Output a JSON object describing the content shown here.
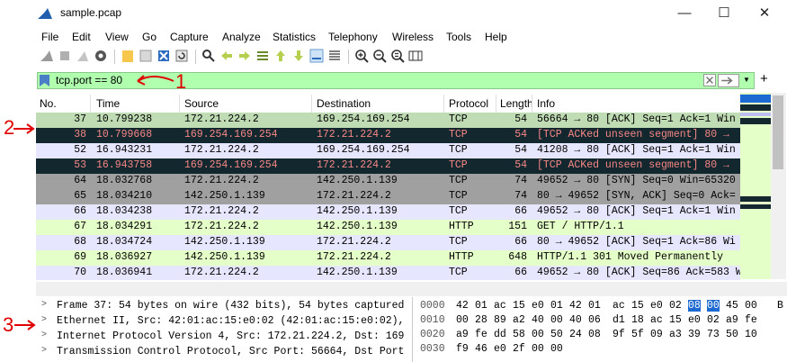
{
  "window": {
    "title": "sample.pcap",
    "minimize": "—",
    "maximize": "☐",
    "close": "✕"
  },
  "menu": [
    "File",
    "Edit",
    "View",
    "Go",
    "Capture",
    "Analyze",
    "Statistics",
    "Telephony",
    "Wireless",
    "Tools",
    "Help"
  ],
  "filter": {
    "value": "tcp.port == 80",
    "plus": "+"
  },
  "columns": [
    "No.",
    "Time",
    "Source",
    "Destination",
    "Protocol",
    "Length",
    "Info"
  ],
  "packets": [
    {
      "no": "37",
      "time": "10.799238",
      "src": "172.21.224.2",
      "dst": "169.254.169.254",
      "proto": "TCP",
      "len": "54",
      "info": "56664 → 80 [ACK] Seq=1 Ack=1 Win",
      "style": "selected"
    },
    {
      "no": "38",
      "time": "10.799668",
      "src": "169.254.169.254",
      "dst": "172.21.224.2",
      "proto": "TCP",
      "len": "54",
      "info": "[TCP ACKed unseen segment] 80 →",
      "style": "bad"
    },
    {
      "no": "52",
      "time": "16.943231",
      "src": "172.21.224.2",
      "dst": "169.254.169.254",
      "proto": "TCP",
      "len": "54",
      "info": "41208 → 80 [ACK] Seq=1 Ack=1 Win",
      "style": "tcp"
    },
    {
      "no": "53",
      "time": "16.943758",
      "src": "169.254.169.254",
      "dst": "172.21.224.2",
      "proto": "TCP",
      "len": "54",
      "info": "[TCP ACKed unseen segment] 80 →",
      "style": "bad"
    },
    {
      "no": "64",
      "time": "18.032768",
      "src": "172.21.224.2",
      "dst": "142.250.1.139",
      "proto": "TCP",
      "len": "74",
      "info": "49652 → 80 [SYN] Seq=0 Win=65320",
      "style": "syn"
    },
    {
      "no": "65",
      "time": "18.034210",
      "src": "142.250.1.139",
      "dst": "172.21.224.2",
      "proto": "TCP",
      "len": "74",
      "info": "80 → 49652 [SYN, ACK] Seq=0 Ack=",
      "style": "syn"
    },
    {
      "no": "66",
      "time": "18.034238",
      "src": "172.21.224.2",
      "dst": "142.250.1.139",
      "proto": "TCP",
      "len": "66",
      "info": "49652 → 80 [ACK] Seq=1 Ack=1 Win",
      "style": "tcp"
    },
    {
      "no": "67",
      "time": "18.034291",
      "src": "172.21.224.2",
      "dst": "142.250.1.139",
      "proto": "HTTP",
      "len": "151",
      "info": "GET / HTTP/1.1",
      "style": "http"
    },
    {
      "no": "68",
      "time": "18.034724",
      "src": "142.250.1.139",
      "dst": "172.21.224.2",
      "proto": "TCP",
      "len": "66",
      "info": "80 → 49652 [ACK] Seq=1 Ack=86 Wi",
      "style": "tcp"
    },
    {
      "no": "69",
      "time": "18.036927",
      "src": "142.250.1.139",
      "dst": "172.21.224.2",
      "proto": "HTTP",
      "len": "648",
      "info": "HTTP/1.1 301 Moved Permanently",
      "style": "http"
    },
    {
      "no": "70",
      "time": "18.036941",
      "src": "172.21.224.2",
      "dst": "142.250.1.139",
      "proto": "TCP",
      "len": "66",
      "info": "49652 → 80 [ACK] Seq=86 Ack=583 W",
      "style": "tcp"
    }
  ],
  "details": [
    "Frame 37: 54 bytes on wire (432 bits), 54 bytes captured",
    "Ethernet II, Src: 42:01:ac:15:e0:02 (42:01:ac:15:e0:02),",
    "Internet Protocol Version 4, Src: 172.21.224.2, Dst: 169",
    "Transmission Control Protocol, Src Port: 56664, Dst Port"
  ],
  "hex": [
    {
      "offset": "0000",
      "bytes": [
        "42",
        "01",
        "ac",
        "15",
        "e0",
        "01",
        "42",
        "01",
        "ac",
        "15",
        "e0",
        "02",
        "08",
        "00",
        "45",
        "00"
      ],
      "ascii": "B"
    },
    {
      "offset": "0010",
      "bytes": [
        "00",
        "28",
        "89",
        "a2",
        "40",
        "00",
        "40",
        "06",
        "d1",
        "18",
        "ac",
        "15",
        "e0",
        "02",
        "a9",
        "fe"
      ],
      "ascii": ""
    },
    {
      "offset": "0020",
      "bytes": [
        "a9",
        "fe",
        "dd",
        "58",
        "00",
        "50",
        "24",
        "08",
        "9f",
        "5f",
        "09",
        "a3",
        "39",
        "73",
        "50",
        "10"
      ],
      "ascii": ""
    },
    {
      "offset": "0030",
      "bytes": [
        "f9",
        "46",
        "e0",
        "2f",
        "00",
        "00"
      ],
      "ascii": ""
    }
  ],
  "annotations": [
    "1",
    "2",
    "3"
  ],
  "colors": {
    "tcp": "#e7e6ff",
    "syn": "#a0a0a0",
    "http": "#e4ffc7",
    "bad": "#12272e",
    "bad_fg": "#f78787",
    "selected": "#c0dcb4",
    "filter_ok": "#afffaf",
    "annotation": "#e00000",
    "hex_highlight": "#1c6ad1"
  },
  "icons": [
    "shark-fin-start-icon",
    "stop-icon",
    "restart-icon",
    "options-icon",
    "open-icon",
    "save-icon",
    "close-file-icon",
    "reload-icon",
    "find-icon",
    "back-icon",
    "forward-icon",
    "goto-icon",
    "first-icon",
    "last-icon",
    "autoscroll-icon",
    "colorize-icon",
    "zoom-in-icon",
    "zoom-out-icon",
    "zoom-reset-icon",
    "resize-columns-icon"
  ]
}
